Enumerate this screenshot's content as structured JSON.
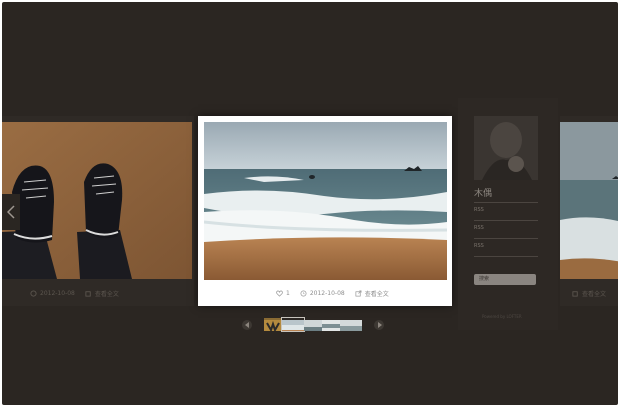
{
  "cards": {
    "left": {
      "date": "2012-10-08",
      "view_label": "查看全文"
    },
    "center": {
      "likes": "1",
      "date": "2012-10-08",
      "view_label": "查看全文"
    },
    "right": {
      "date": "2012-10-08",
      "view_label": "查看全文"
    }
  },
  "profile": {
    "name": "木偶",
    "links": [
      "RSS",
      "RSS",
      "RSS"
    ],
    "search_label": "搜索",
    "footer": "Powered by LOFTER"
  },
  "pager": {
    "prev_icon": "chevron-left-icon",
    "next_icon": "chevron-right-icon",
    "thumb_count": 5
  },
  "colors": {
    "backdrop": "#2b2622",
    "card_white": "#ffffff",
    "sand": "#b1794a",
    "sea": "#5e7f87"
  }
}
